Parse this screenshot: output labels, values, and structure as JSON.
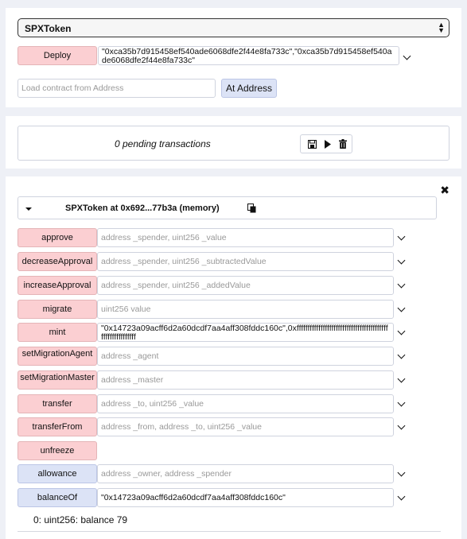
{
  "contract_select": {
    "value": "SPXToken"
  },
  "deploy": {
    "label": "Deploy",
    "value": "\"0xca35b7d915458ef540ade6068dfe2f44e8fa733c\",\"0xca35b7d915458ef540ade6068dfe2f44e8fa733c\""
  },
  "at_address": {
    "placeholder": "Load contract from Address",
    "label": "At Address"
  },
  "pending": {
    "text": "0 pending transactions"
  },
  "instance": {
    "title": "SPXToken at 0x692...77b3a (memory)",
    "functions": [
      {
        "label": "approve",
        "kind": "transact",
        "placeholder": "address _spender, uint256 _value",
        "value": ""
      },
      {
        "label": "decreaseApproval",
        "kind": "transact",
        "placeholder": "address _spender, uint256 _subtractedValue",
        "value": ""
      },
      {
        "label": "increaseApproval",
        "kind": "transact",
        "placeholder": "address _spender, uint256 _addedValue",
        "value": ""
      },
      {
        "label": "migrate",
        "kind": "transact",
        "placeholder": "uint256 value",
        "value": ""
      },
      {
        "label": "mint",
        "kind": "transact",
        "placeholder": "",
        "value": "\"0x14723a09acff6d2a60dcdf7aa4aff308fddc160c\",0xffffffffffffffffffffffffffffffffffffffffffffffffffffffffff"
      },
      {
        "label": "setMigrationAgent",
        "kind": "transact",
        "placeholder": "address _agent",
        "value": ""
      },
      {
        "label": "setMigrationMaster",
        "kind": "transact",
        "placeholder": "address _master",
        "value": ""
      },
      {
        "label": "transfer",
        "kind": "transact",
        "placeholder": "address _to, uint256 _value",
        "value": ""
      },
      {
        "label": "transferFrom",
        "kind": "transact",
        "placeholder": "address _from, address _to, uint256 _value",
        "value": ""
      },
      {
        "label": "unfreeze",
        "kind": "transact",
        "placeholder": null,
        "value": ""
      },
      {
        "label": "allowance",
        "kind": "call",
        "placeholder": "address _owner, address _spender",
        "value": ""
      },
      {
        "label": "balanceOf",
        "kind": "call",
        "placeholder": "",
        "value": "\"0x14723a09acff6d2a60dcdf7aa4aff308fddc160c\""
      }
    ],
    "output": "0: uint256: balance 79"
  },
  "icons": {
    "save": "save-icon",
    "play": "play-icon",
    "trash": "trash-icon",
    "close": "close-icon",
    "copy": "copy-icon",
    "caret": "caret-down-icon",
    "chevron": "chevron-down-icon"
  },
  "colors": {
    "transact": "#fbcfd2",
    "call": "#dce3f6",
    "background": "#eef0f6"
  }
}
